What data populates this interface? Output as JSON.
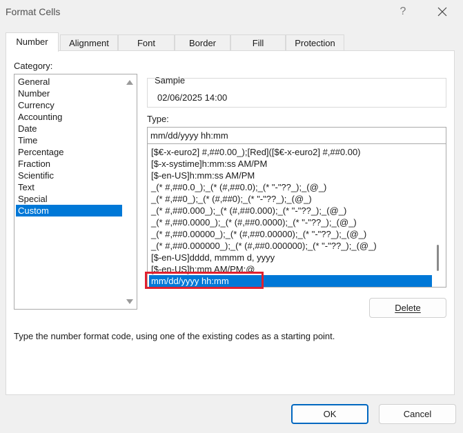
{
  "window": {
    "title": "Format Cells",
    "help_label": "?"
  },
  "tabs": [
    {
      "label": "Number",
      "active": true
    },
    {
      "label": "Alignment",
      "active": false
    },
    {
      "label": "Font",
      "active": false
    },
    {
      "label": "Border",
      "active": false
    },
    {
      "label": "Fill",
      "active": false
    },
    {
      "label": "Protection",
      "active": false
    }
  ],
  "category": {
    "label": "Category:",
    "items": [
      "General",
      "Number",
      "Currency",
      "Accounting",
      "Date",
      "Time",
      "Percentage",
      "Fraction",
      "Scientific",
      "Text",
      "Special",
      "Custom"
    ],
    "selected": "Custom"
  },
  "sample": {
    "label": "Sample",
    "value": "02/06/2025 14:00"
  },
  "type": {
    "label": "Type:",
    "value": "mm/dd/yyyy hh:mm",
    "formats": [
      "[$€-x-euro2] #,##0.00_);[Red]([$€-x-euro2] #,##0.00)",
      "[$-x-systime]h:mm:ss AM/PM",
      "[$-en-US]h:mm:ss AM/PM",
      "_(* #,##0.0_);_(* (#,##0.0);_(* \"-\"??_);_(@_)",
      "_(* #,##0_);_(* (#,##0);_(* \"-\"??_);_(@_)",
      "_(* #,##0.000_);_(* (#,##0.000);_(* \"-\"??_);_(@_)",
      "_(* #,##0.0000_);_(* (#,##0.0000);_(* \"-\"??_);_(@_)",
      "_(* #,##0.00000_);_(* (#,##0.00000);_(* \"-\"??_);_(@_)",
      "_(* #,##0.000000_);_(* (#,##0.000000);_(* \"-\"??_);_(@_)",
      "[$-en-US]dddd, mmmm d, yyyy",
      "[$-en-US]h:mm AM/PM;@",
      "mm/dd/yyyy hh:mm"
    ],
    "selected": "mm/dd/yyyy hh:mm"
  },
  "buttons": {
    "delete": "Delete",
    "ok": "OK",
    "cancel": "Cancel"
  },
  "description": "Type the number format code, using one of the existing codes as a starting point.",
  "colors": {
    "accent": "#0078d7",
    "highlight_border": "#e0202f",
    "dialog_bg": "#f0f0f0"
  },
  "icons": {
    "close": "close-icon",
    "scroll_up": "scroll-up-arrow-icon",
    "scroll_down": "scroll-down-arrow-icon"
  }
}
